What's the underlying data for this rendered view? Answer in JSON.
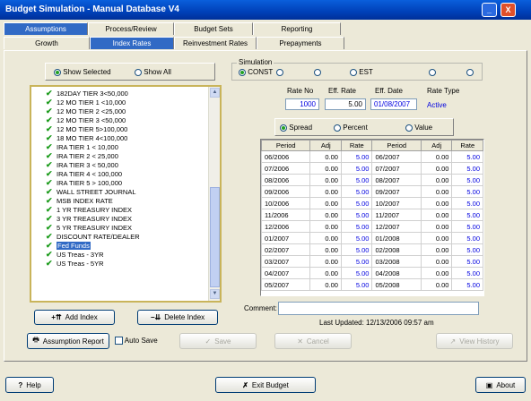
{
  "window": {
    "title": "Budget Simulation - Manual Database V4",
    "min_label": "_",
    "close_label": "X"
  },
  "tabs_top": [
    {
      "label": "Assumptions",
      "active": true
    },
    {
      "label": "Process/Review",
      "active": false
    },
    {
      "label": "Budget Sets",
      "active": false
    },
    {
      "label": "Reporting",
      "active": false
    }
  ],
  "tabs_sub": [
    {
      "label": "Growth",
      "active": false
    },
    {
      "label": "Index Rates",
      "active": true
    },
    {
      "label": "Reinvestment Rates",
      "active": false
    },
    {
      "label": "Prepayments",
      "active": false
    }
  ],
  "show_options": {
    "selected_label": "Show Selected",
    "all_label": "Show All",
    "selected": "Show Selected"
  },
  "index_list": [
    {
      "label": "182DAY TIER 3<50,000",
      "checked": true
    },
    {
      "label": "12 MO TIER 1 <10,000",
      "checked": true
    },
    {
      "label": "12 MO TIER 2 <25,000",
      "checked": true
    },
    {
      "label": "12 MO TIER 3 <50,000",
      "checked": true
    },
    {
      "label": "12 MO TIER 5>100,000",
      "checked": true
    },
    {
      "label": "18 MO TIER 4<100,000",
      "checked": true
    },
    {
      "label": "IRA TIER 1 < 10,000",
      "checked": true
    },
    {
      "label": "IRA TIER 2 < 25,000",
      "checked": true
    },
    {
      "label": "IRA TIER 3 < 50,000",
      "checked": true
    },
    {
      "label": "IRA TIER 4 < 100,000",
      "checked": true
    },
    {
      "label": "IRA TIER 5 > 100,000",
      "checked": true
    },
    {
      "label": "WALL STREET JOURNAL",
      "checked": true
    },
    {
      "label": "MSB INDEX RATE",
      "checked": true
    },
    {
      "label": "1 YR TREASURY INDEX",
      "checked": true
    },
    {
      "label": "3 YR TREASURY INDEX",
      "checked": true
    },
    {
      "label": "5 YR TREASURY INDEX",
      "checked": true
    },
    {
      "label": "DISCOUNT RATE/DEALER",
      "checked": true
    },
    {
      "label": "Fed Funds",
      "checked": true,
      "selected": true
    },
    {
      "label": "US Treas - 3YR",
      "checked": true
    },
    {
      "label": "US Treas - 5YR",
      "checked": true
    }
  ],
  "simulation": {
    "legend": "Simulation",
    "options": [
      "CONST",
      "",
      "",
      "EST",
      "",
      ""
    ],
    "selected": "CONST"
  },
  "rate_fields": {
    "rate_no_label": "Rate No",
    "eff_rate_label": "Eff. Rate",
    "eff_date_label": "Eff. Date",
    "rate_type_label": "Rate Type",
    "rate_no": "1000",
    "eff_rate": "5.00",
    "eff_date": "01/08/2007",
    "rate_type": "Active"
  },
  "mode_options": {
    "options": [
      "Spread",
      "Percent",
      "Value"
    ],
    "selected": "Spread"
  },
  "rate_table": {
    "headers": [
      "Period",
      "Adj",
      "Rate",
      "Period",
      "Adj",
      "Rate"
    ],
    "rows": [
      [
        "06/2006",
        "0.00",
        "5.00",
        "06/2007",
        "0.00",
        "5.00"
      ],
      [
        "07/2006",
        "0.00",
        "5.00",
        "07/2007",
        "0.00",
        "5.00"
      ],
      [
        "08/2006",
        "0.00",
        "5.00",
        "08/2007",
        "0.00",
        "5.00"
      ],
      [
        "09/2006",
        "0.00",
        "5.00",
        "09/2007",
        "0.00",
        "5.00"
      ],
      [
        "10/2006",
        "0.00",
        "5.00",
        "10/2007",
        "0.00",
        "5.00"
      ],
      [
        "11/2006",
        "0.00",
        "5.00",
        "11/2007",
        "0.00",
        "5.00"
      ],
      [
        "12/2006",
        "0.00",
        "5.00",
        "12/2007",
        "0.00",
        "5.00"
      ],
      [
        "01/2007",
        "0.00",
        "5.00",
        "01/2008",
        "0.00",
        "5.00"
      ],
      [
        "02/2007",
        "0.00",
        "5.00",
        "02/2008",
        "0.00",
        "5.00"
      ],
      [
        "03/2007",
        "0.00",
        "5.00",
        "03/2008",
        "0.00",
        "5.00"
      ],
      [
        "04/2007",
        "0.00",
        "5.00",
        "04/2008",
        "0.00",
        "5.00"
      ],
      [
        "05/2007",
        "0.00",
        "5.00",
        "05/2008",
        "0.00",
        "5.00"
      ]
    ]
  },
  "comment": {
    "label": "Comment:",
    "value": ""
  },
  "last_updated": "Last Updated: 12/13/2006 09:57 am",
  "buttons": {
    "add_index": "Add Index",
    "delete_index": "Delete Index",
    "assumption_report": "Assumption Report",
    "auto_save": "Auto Save",
    "save": "Save",
    "cancel": "Cancel",
    "view_history": "View History",
    "help": "Help",
    "exit_budget": "Exit Budget",
    "about": "About"
  },
  "colors": {
    "title_bar": "#0040b8",
    "accent": "#316ac5",
    "value_text": "#0000e0",
    "check": "#1a9a1a"
  }
}
